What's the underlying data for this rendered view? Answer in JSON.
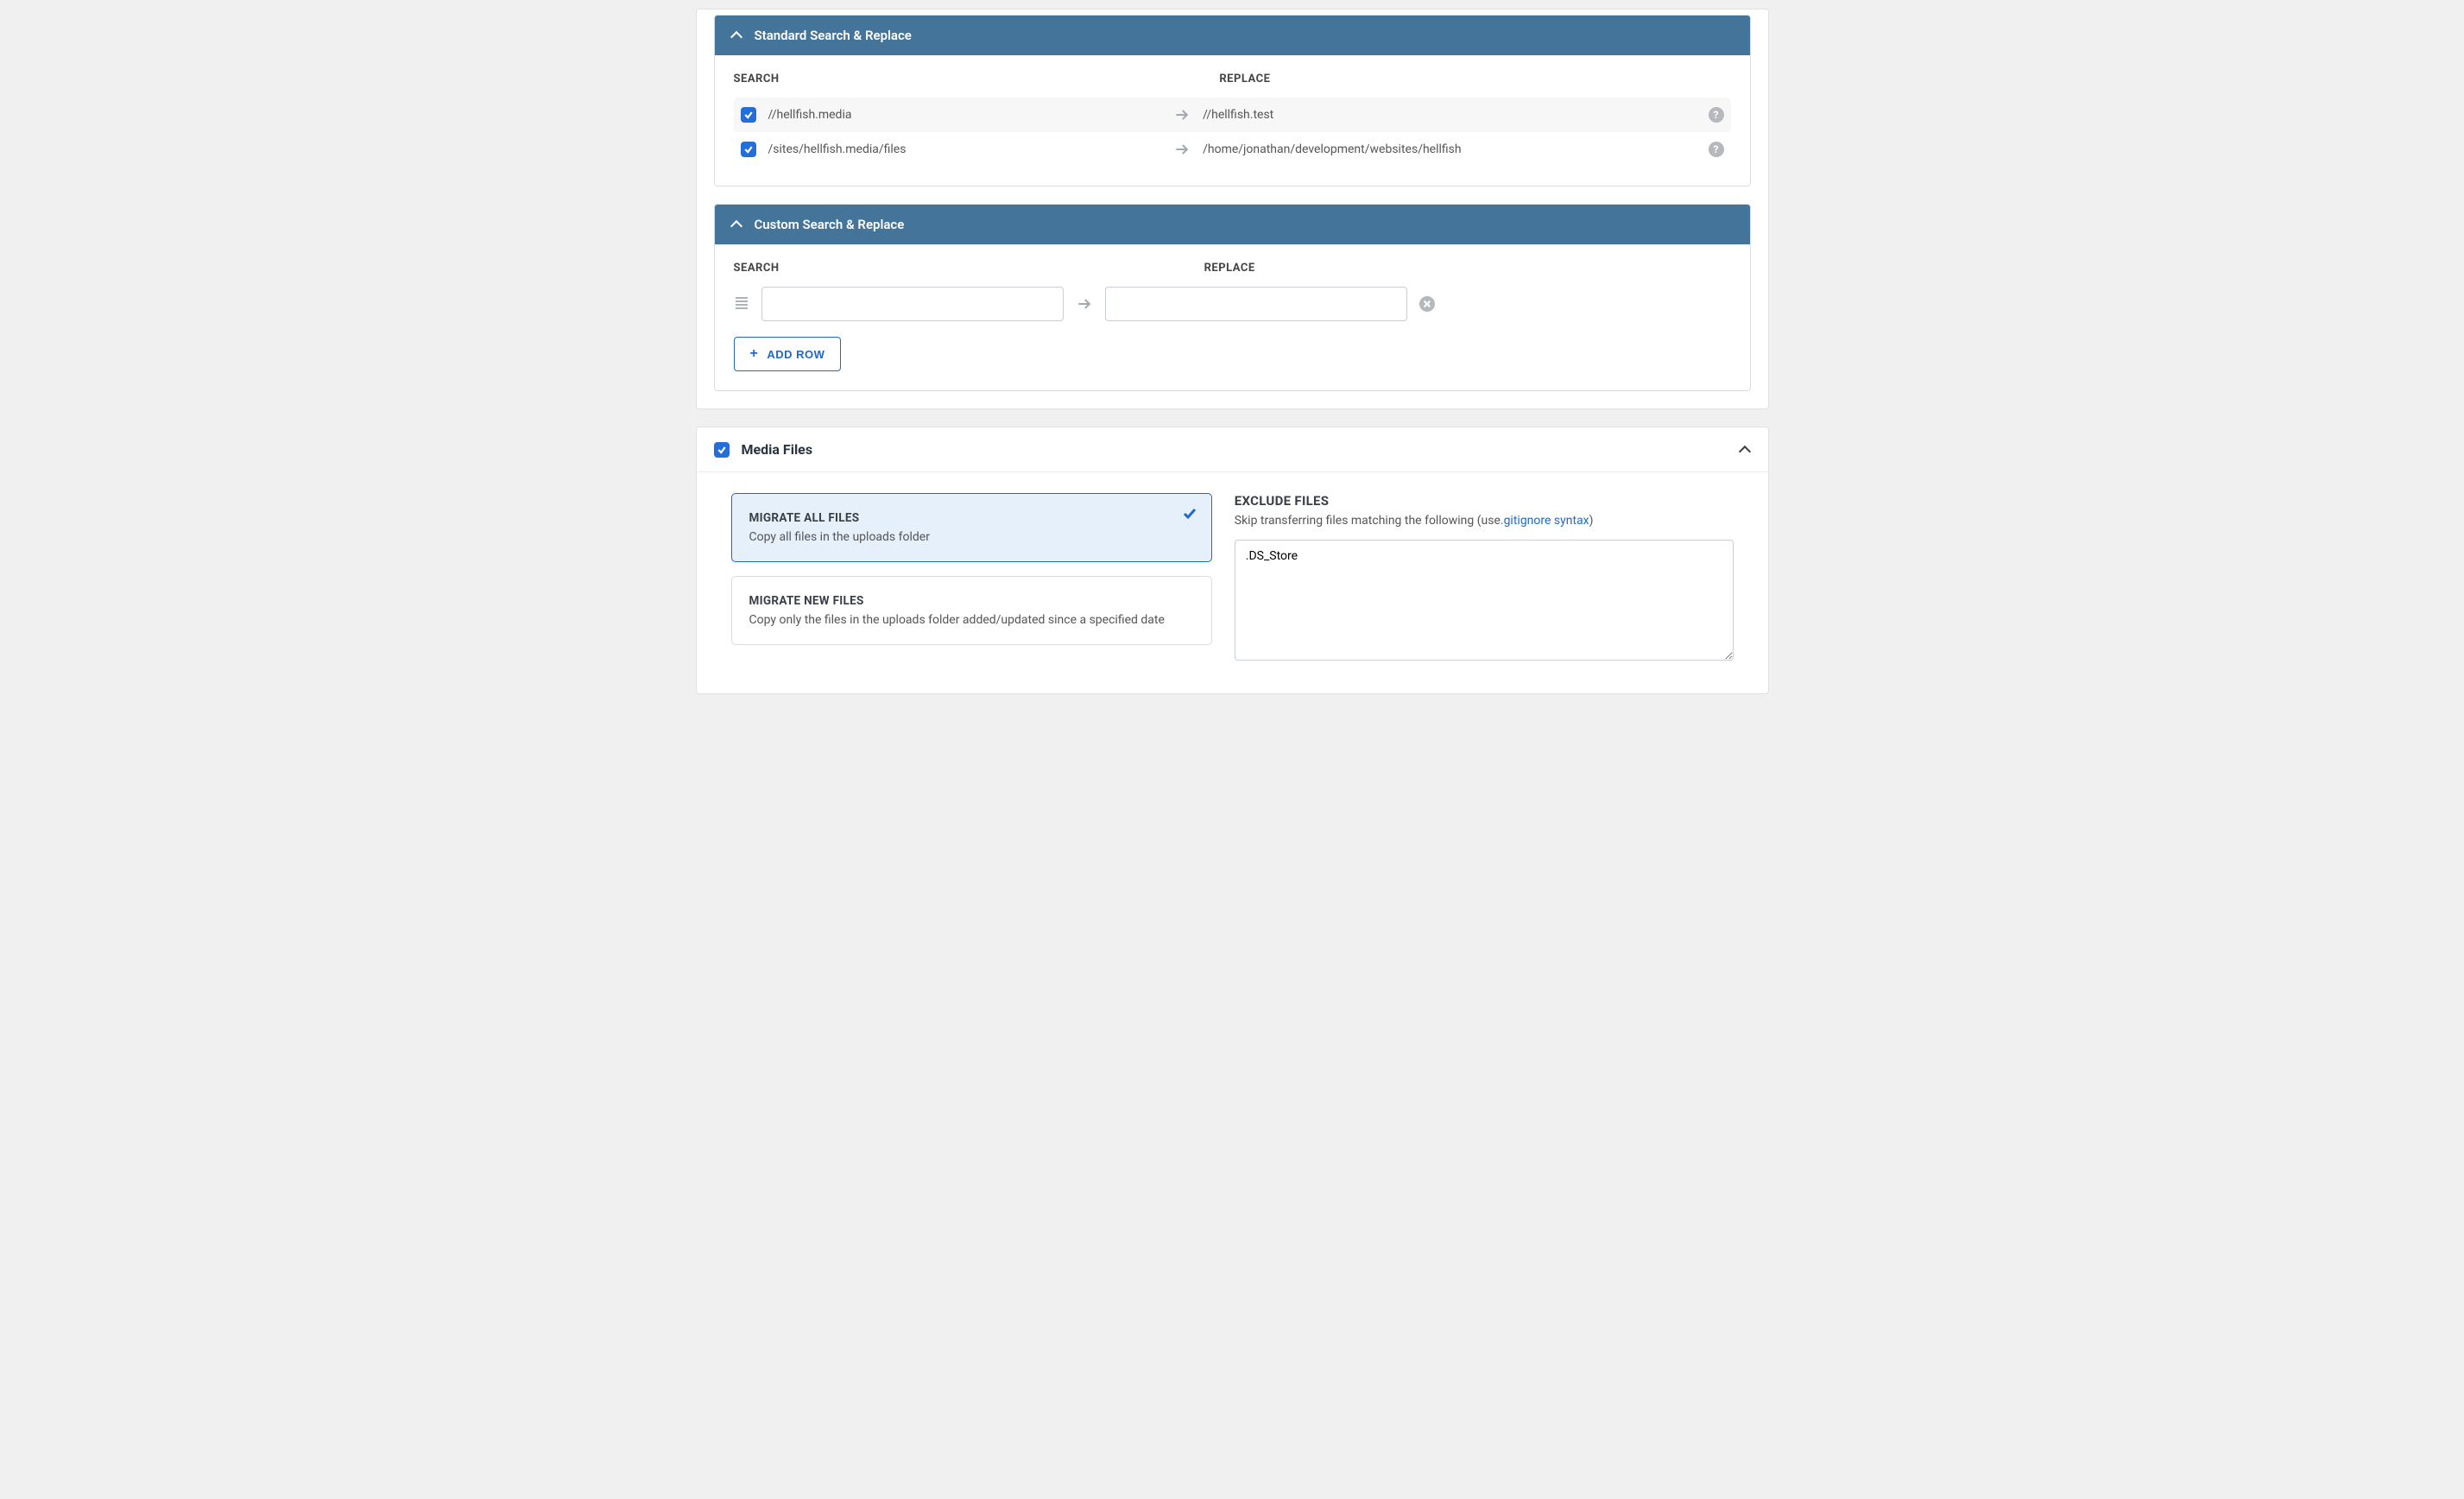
{
  "standard": {
    "title": "Standard Search & Replace",
    "search_label": "SEARCH",
    "replace_label": "REPLACE",
    "rows": [
      {
        "search": "//hellfish.media",
        "replace": "//hellfish.test",
        "checked": true
      },
      {
        "search": "/sites/hellfish.media/files",
        "replace": "/home/jonathan/development/websites/hellfish",
        "checked": true
      }
    ]
  },
  "custom": {
    "title": "Custom Search & Replace",
    "search_label": "SEARCH",
    "replace_label": "REPLACE",
    "add_row": "ADD ROW"
  },
  "media": {
    "title": "Media Files",
    "opts": [
      {
        "title": "MIGRATE ALL FILES",
        "desc": "Copy all files in the uploads folder",
        "selected": true
      },
      {
        "title": "MIGRATE NEW FILES",
        "desc": "Copy only the files in the uploads folder added/updated since a specified date",
        "selected": false
      }
    ],
    "excl": {
      "title": "EXCLUDE FILES",
      "sub_pre": "Skip transferring files matching the following (use",
      "link": ".gitignore syntax",
      "sub_post": ")",
      "value": ".DS_Store"
    }
  }
}
